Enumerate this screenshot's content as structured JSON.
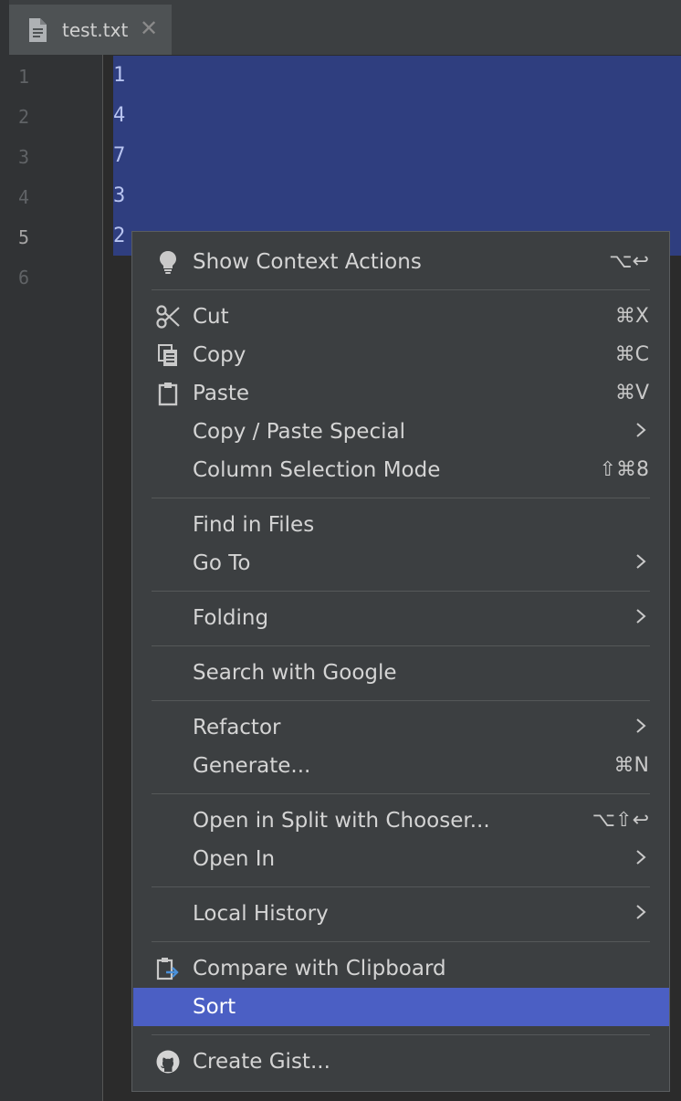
{
  "tab": {
    "filename": "test.txt",
    "close_glyph": "✕"
  },
  "gutter": {
    "line_numbers": [
      "1",
      "2",
      "3",
      "4",
      "5",
      "6"
    ],
    "current_line": "5"
  },
  "editor": {
    "lines": [
      "1",
      "4",
      "7",
      "3",
      "2"
    ]
  },
  "menu": {
    "show_context_actions": {
      "label": "Show Context Actions",
      "shortcut": "⌥↩",
      "icon": "bulb-icon"
    },
    "cut": {
      "label": "Cut",
      "shortcut": "⌘X",
      "icon": "scissors-icon"
    },
    "copy": {
      "label": "Copy",
      "shortcut": "⌘C",
      "icon": "copy-icon"
    },
    "paste": {
      "label": "Paste",
      "shortcut": "⌘V",
      "icon": "clipboard-icon"
    },
    "copy_paste_special": {
      "label": "Copy / Paste Special",
      "submenu": true
    },
    "column_selection_mode": {
      "label": "Column Selection Mode",
      "shortcut": "⇧⌘8"
    },
    "find_in_files": {
      "label": "Find in Files"
    },
    "go_to": {
      "label": "Go To",
      "submenu": true
    },
    "folding": {
      "label": "Folding",
      "submenu": true
    },
    "search_with_google": {
      "label": "Search with Google"
    },
    "refactor": {
      "label": "Refactor",
      "submenu": true
    },
    "generate": {
      "label": "Generate...",
      "shortcut": "⌘N"
    },
    "open_in_split": {
      "label": "Open in Split with Chooser...",
      "shortcut": "⌥⇧↩"
    },
    "open_in": {
      "label": "Open In",
      "submenu": true
    },
    "local_history": {
      "label": "Local History",
      "submenu": true
    },
    "compare_with_clipboard": {
      "label": "Compare with Clipboard",
      "icon": "compare-clipboard-icon"
    },
    "sort": {
      "label": "Sort",
      "highlighted": true
    },
    "create_gist": {
      "label": "Create Gist...",
      "icon": "github-icon"
    }
  },
  "colors": {
    "selection": "#2f3e7f",
    "menu_background": "#3c3f41",
    "menu_highlight": "#4b5fc4",
    "editor_background": "#2b2b2b",
    "gutter_background": "#313335"
  }
}
